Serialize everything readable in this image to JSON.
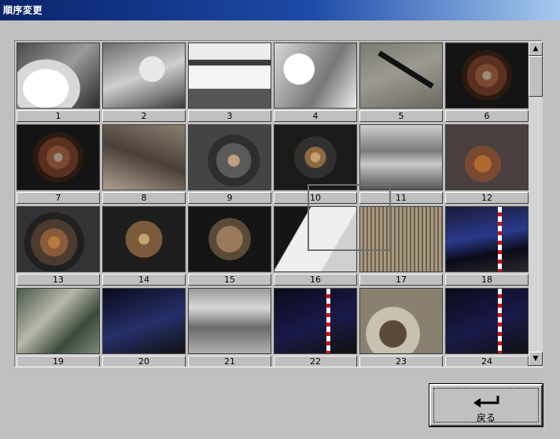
{
  "window": {
    "title": "順序変更"
  },
  "thumbnails": [
    {
      "caption": "1",
      "style": "t-car-white",
      "icon": "car-photo"
    },
    {
      "caption": "2",
      "style": "t-engine",
      "icon": "engine-photo"
    },
    {
      "caption": "3",
      "style": "t-bay",
      "icon": "engine-bay-photo"
    },
    {
      "caption": "4",
      "style": "t-white-panel",
      "icon": "body-panel-photo"
    },
    {
      "caption": "5",
      "style": "t-ground",
      "icon": "ground-part-photo"
    },
    {
      "caption": "6",
      "style": "t-rotor",
      "icon": "brake-rotor-photo"
    },
    {
      "caption": "7",
      "style": "t-rotor",
      "icon": "brake-rotor-photo"
    },
    {
      "caption": "8",
      "style": "t-susp",
      "icon": "suspension-photo"
    },
    {
      "caption": "9",
      "style": "t-drum",
      "icon": "brake-drum-photo"
    },
    {
      "caption": "10",
      "style": "t-hub-dark",
      "icon": "hub-photo"
    },
    {
      "caption": "11",
      "style": "t-interior",
      "icon": "interior-photo"
    },
    {
      "caption": "12",
      "style": "t-brown-hub",
      "icon": "hub-photo"
    },
    {
      "caption": "13",
      "style": "t-rotor-bright",
      "icon": "brake-rotor-photo"
    },
    {
      "caption": "14",
      "style": "t-dome",
      "icon": "hub-photo"
    },
    {
      "caption": "15",
      "style": "t-dome2",
      "icon": "hub-photo"
    },
    {
      "caption": "16",
      "style": "t-bag",
      "icon": "airbag-photo"
    },
    {
      "caption": "17",
      "style": "t-radiator",
      "icon": "radiator-photo"
    },
    {
      "caption": "18",
      "style": "t-blue-car",
      "icon": "blue-car-photo"
    },
    {
      "caption": "19",
      "style": "t-messy",
      "icon": "engine-bay-photo"
    },
    {
      "caption": "20",
      "style": "t-blue-car2",
      "icon": "blue-car-photo"
    },
    {
      "caption": "21",
      "style": "t-frame",
      "icon": "frame-photo"
    },
    {
      "caption": "22",
      "style": "t-pole",
      "icon": "measuring-pole-photo"
    },
    {
      "caption": "23",
      "style": "t-wheelwell",
      "icon": "wheel-well-photo"
    },
    {
      "caption": "24",
      "style": "t-pole",
      "icon": "measuring-pole-photo"
    }
  ],
  "scrollbar": {
    "up_glyph": "▲",
    "down_glyph": "▼"
  },
  "back_button": {
    "label": "戻る",
    "icon": "return-arrow-icon"
  }
}
